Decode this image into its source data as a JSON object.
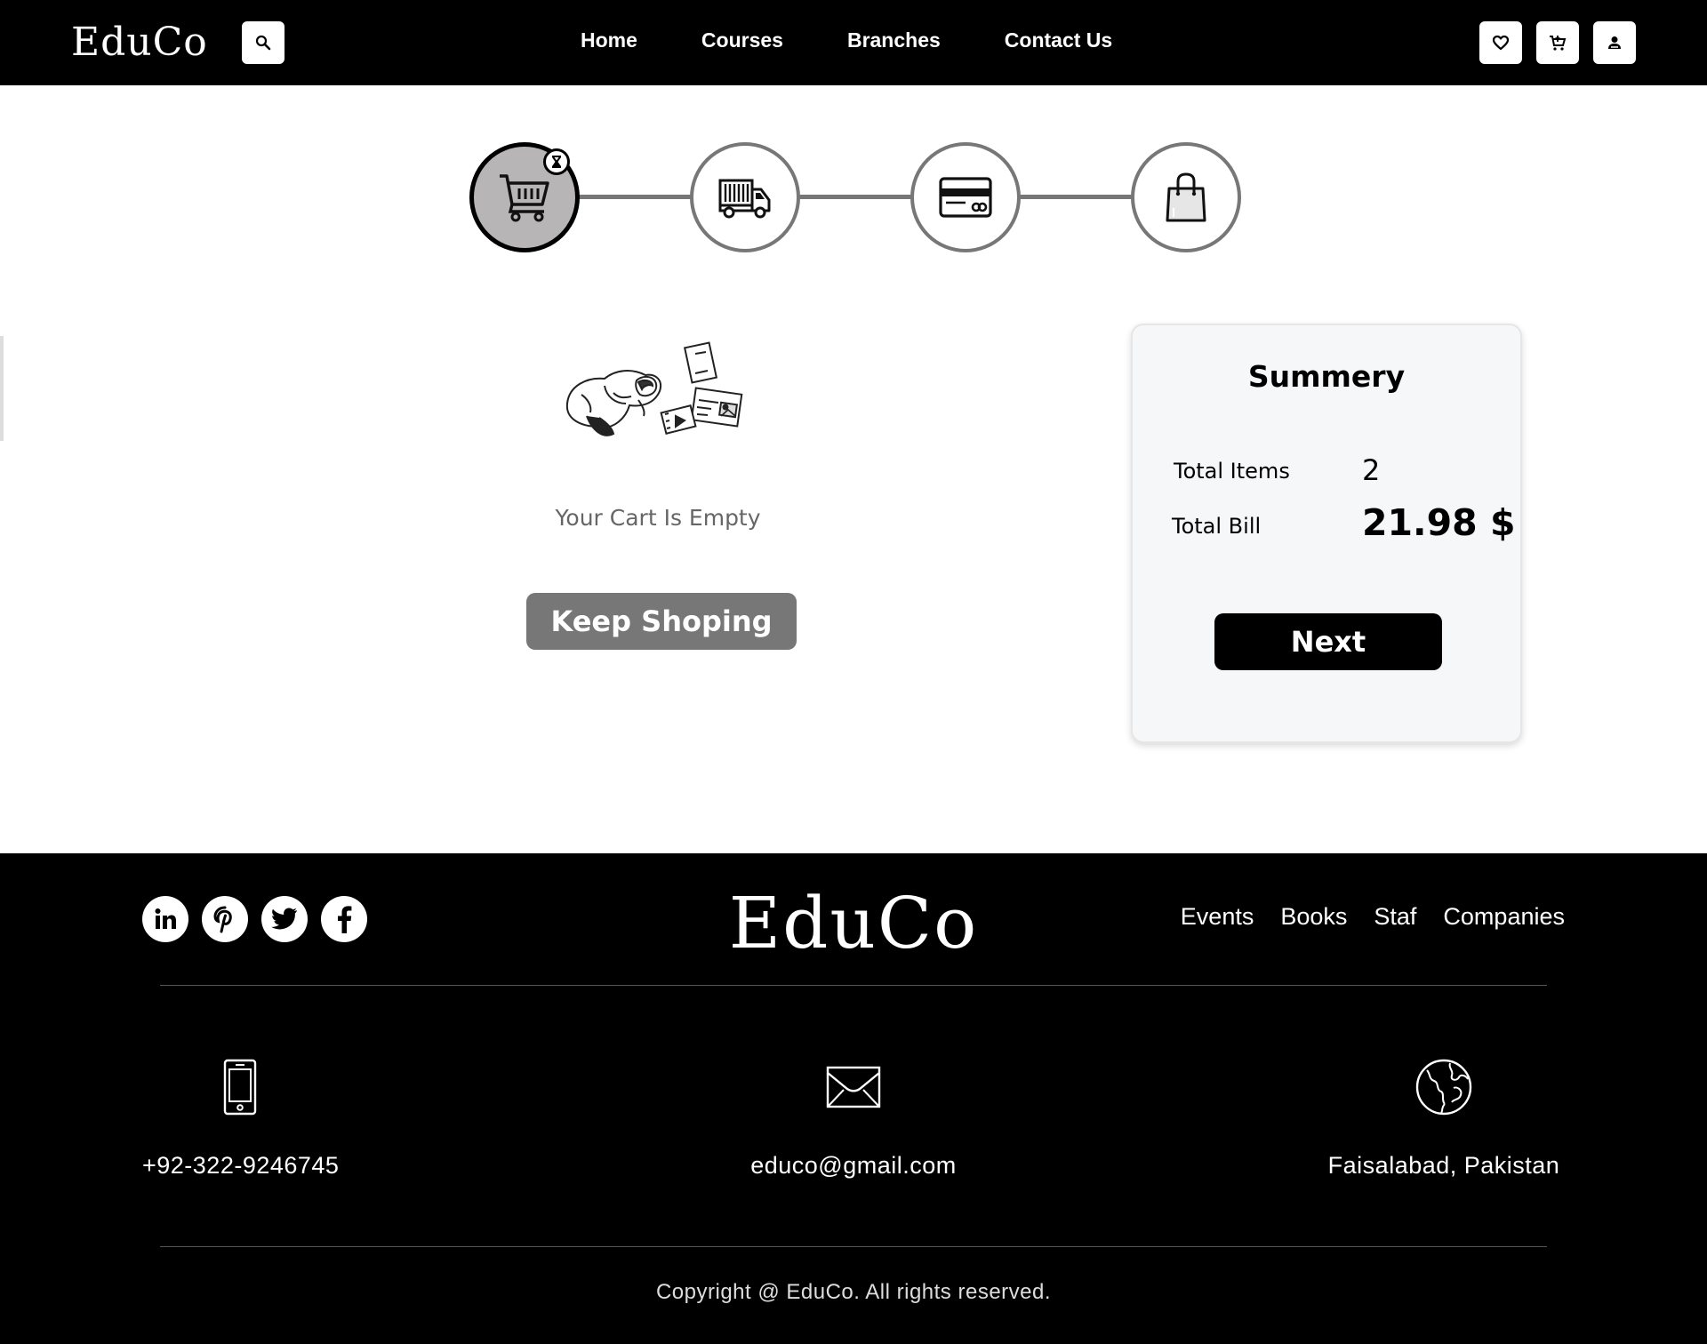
{
  "header": {
    "logo": "EduCo",
    "search_icon": "search-icon",
    "nav": [
      "Home",
      "Courses",
      "Branches",
      "Contact Us"
    ],
    "icons": [
      "heart-icon",
      "cart-icon",
      "user-icon"
    ]
  },
  "stepper": {
    "steps": [
      "cart-icon",
      "truck-icon",
      "credit-card-icon",
      "shopping-bag-icon"
    ],
    "active_step": 1,
    "badge_icon": "hourglass-icon"
  },
  "cart": {
    "empty_text": "Your Cart Is Empty",
    "keep_shopping": "Keep Shoping"
  },
  "summary": {
    "title": "Summery",
    "total_items_label": "Total Items",
    "total_items_value": "2",
    "total_bill_label": "Total Bill",
    "total_bill_value": "21.98 $",
    "next_label": "Next"
  },
  "footer": {
    "socials": [
      "linkedin-icon",
      "pinterest-icon",
      "twitter-icon",
      "facebook-icon"
    ],
    "logo": "EduCo",
    "links": [
      "Events",
      "Books",
      "Staf",
      "Companies"
    ],
    "phone": "+92-322-9246745",
    "email": "educo@gmail.com",
    "location": "Faisalabad, Pakistan",
    "copyright": "Copyright @ EduCo. All rights reserved."
  },
  "colors": {
    "header_bg": "#000000",
    "active_step_bg": "#b7b5b5",
    "button_grey": "#777777",
    "summary_bg": "#f6f7f8"
  }
}
